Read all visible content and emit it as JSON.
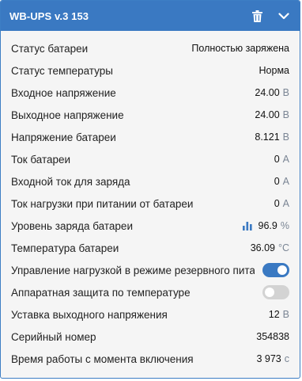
{
  "header": {
    "title": "WB-UPS v.3 153",
    "accent_color": "#3a79c2",
    "icons": [
      "trash-icon",
      "chevron-down-icon"
    ]
  },
  "rows": [
    {
      "label": "Статус батареи",
      "value": "Полностью заряжена",
      "unit": ""
    },
    {
      "label": "Статус температуры",
      "value": "Норма",
      "unit": ""
    },
    {
      "label": "Входное напряжение",
      "value": "24.00",
      "unit": "В"
    },
    {
      "label": "Выходное напряжение",
      "value": "24.00",
      "unit": "В"
    },
    {
      "label": "Напряжение батареи",
      "value": "8.121",
      "unit": "В"
    },
    {
      "label": "Ток батареи",
      "value": "0",
      "unit": "A"
    },
    {
      "label": "Входной ток для заряда",
      "value": "0",
      "unit": "A"
    },
    {
      "label": "Ток нагрузки при питании от батареи",
      "value": "0",
      "unit": "A"
    },
    {
      "label": "Уровень заряда батареи",
      "value": "96.9",
      "unit": "%",
      "icon": "bar-chart-icon"
    },
    {
      "label": "Температура батареи",
      "value": "36.09",
      "unit": "°C"
    },
    {
      "label": "Управление нагрузкой в режиме резервного питания",
      "toggle": true
    },
    {
      "label": "Аппаратная защита по температуре",
      "toggle": false
    },
    {
      "label": "Уставка выходного напряжения",
      "value": "12",
      "unit": "В"
    },
    {
      "label": "Серийный номер",
      "value": "354838",
      "unit": ""
    },
    {
      "label": "Время работы с момента включения",
      "value": "3 973",
      "unit": "с"
    }
  ]
}
